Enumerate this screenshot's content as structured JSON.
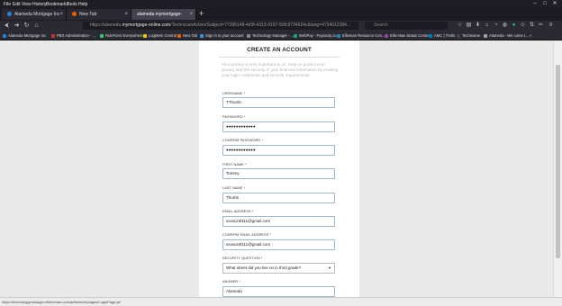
{
  "menu": [
    "File",
    "Edit",
    "View",
    "History",
    "Bookmarks",
    "Tools",
    "Help"
  ],
  "tabs": [
    {
      "label": "Alameda Mortgage Inc",
      "color": "#2a7fd4"
    },
    {
      "label": "New Tab",
      "color": "#e66000"
    },
    {
      "label": "alameda.mymortgage-online.co",
      "color": "#777777"
    }
  ],
  "url": {
    "prefix": "https://alameda.",
    "domain": "mymortgage-online.com",
    "rest": "/TechnicianAction/Subject=77396148-4d3f-4313-9167-50fc9734624c&lang=4734012284..."
  },
  "search": {
    "placeholder": "Search"
  },
  "bookmarks": [
    {
      "label": "Alameda Mortgage Inc",
      "color": "#2a7fd4"
    },
    {
      "label": "PBX Administration - ...",
      "color": "#c0392b"
    },
    {
      "label": "RoleForm Everywhere...",
      "color": "#2ecc71"
    },
    {
      "label": "LogMeIn Central",
      "color": "#f1c40f"
    },
    {
      "label": "New Tab",
      "color": "#e66000"
    },
    {
      "label": "Sign in to your account",
      "color": "#3498db"
    },
    {
      "label": "Technology Manager - ...",
      "color": "#7f8c8d"
    },
    {
      "label": "WebPay - Paylocity.co...",
      "color": "#16a085"
    },
    {
      "label": "Ellieman Resource Cen...",
      "color": "#2980b9"
    },
    {
      "label": "Ellie Mae Status Center",
      "color": "#8e44ad"
    },
    {
      "label": "AMC | Trello",
      "color": "#0079bf"
    },
    {
      "label": "Techieame",
      "color": "#34495e"
    },
    {
      "label": "Alameda - We come t...",
      "color": "#95a5a6"
    }
  ],
  "form": {
    "title": "CREATE AN ACCOUNT",
    "intro": "Your privacy is very important to us. Help us protect your privacy and the security of your financial information by creating your login credentials and security requirements.",
    "required_mark": "*",
    "fields": [
      {
        "label": "USERNAME",
        "value": "TThumb"
      },
      {
        "label": "PASSWORD",
        "value": "●●●●●●●●●●●●"
      },
      {
        "label": "CONFIRM PASSWORD",
        "value": "●●●●●●●●●●●●"
      },
      {
        "label": "FIRST NAME",
        "value": "Tommy"
      },
      {
        "label": "LAST NAME",
        "value": "Thumb"
      },
      {
        "label": "EMAIL ADDRESS",
        "value": "xxxsuzel111@gmail.com"
      },
      {
        "label": "CONFIRM EMAIL ADDRESS",
        "value": "xxxsuzel111@gmail.com"
      },
      {
        "label": "SECURITY QUESTION",
        "value": "What street did you live on in third grade?"
      },
      {
        "label": "ANSWER",
        "value": "Alameda"
      }
    ]
  },
  "status": "https://technologymanager.elliemmae.com/adfservice/pages/LoginPage.jsf"
}
